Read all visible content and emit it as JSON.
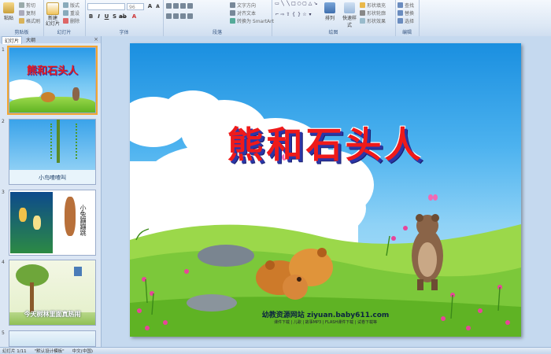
{
  "ribbon": {
    "groups": [
      "剪贴板",
      "幻灯片",
      "字体",
      "段落",
      "绘图",
      "编辑"
    ],
    "paste_label": "粘贴",
    "cut_label": "剪切",
    "copy_label": "复制",
    "format_painter_label": "格式刷",
    "new_slide_label": "新建\n幻灯片",
    "layout_label": "版式",
    "reset_label": "重设",
    "delete_label": "删除",
    "font_name": "",
    "font_size": "96",
    "text_direction_label": "文字方向",
    "align_text_label": "对齐文本",
    "smartart_label": "转换为 SmartArt",
    "arrange_label": "排列",
    "quick_styles_label": "快速样式",
    "shape_fill_label": "形状填充",
    "shape_outline_label": "形状轮廓",
    "shape_effects_label": "形状效果",
    "find_label": "查找",
    "replace_label": "替换",
    "select_label": "选择"
  },
  "pane": {
    "tab_slides": "幻灯片",
    "tab_outline": "大纲",
    "close": "×"
  },
  "thumbnails": [
    {
      "num": "1",
      "title": "熊和石头人"
    },
    {
      "num": "2",
      "caption": "小鸟喳喳叫"
    },
    {
      "num": "3",
      "caption": "小兔蹦蹦跳"
    },
    {
      "num": "4",
      "caption": "今天树林里面真热闹"
    },
    {
      "num": "5",
      "caption": ""
    }
  ],
  "slide": {
    "title": "熊和石头人",
    "site_line": "幼教资源网站  ziyuan.baby611.com",
    "tags_line": "课件下载 | 儿歌 | 故事MP3 | FLASH课件下载 | 试卷下载等"
  },
  "status": {
    "slide_counter": "幻灯片 1/11",
    "theme": "\"默认设计模板\"",
    "language": "中文(中国)"
  },
  "colors": {
    "title_red": "#ef1a1a",
    "title_shadow": "#2a36a8",
    "selected_thumb": "#f3a632"
  }
}
